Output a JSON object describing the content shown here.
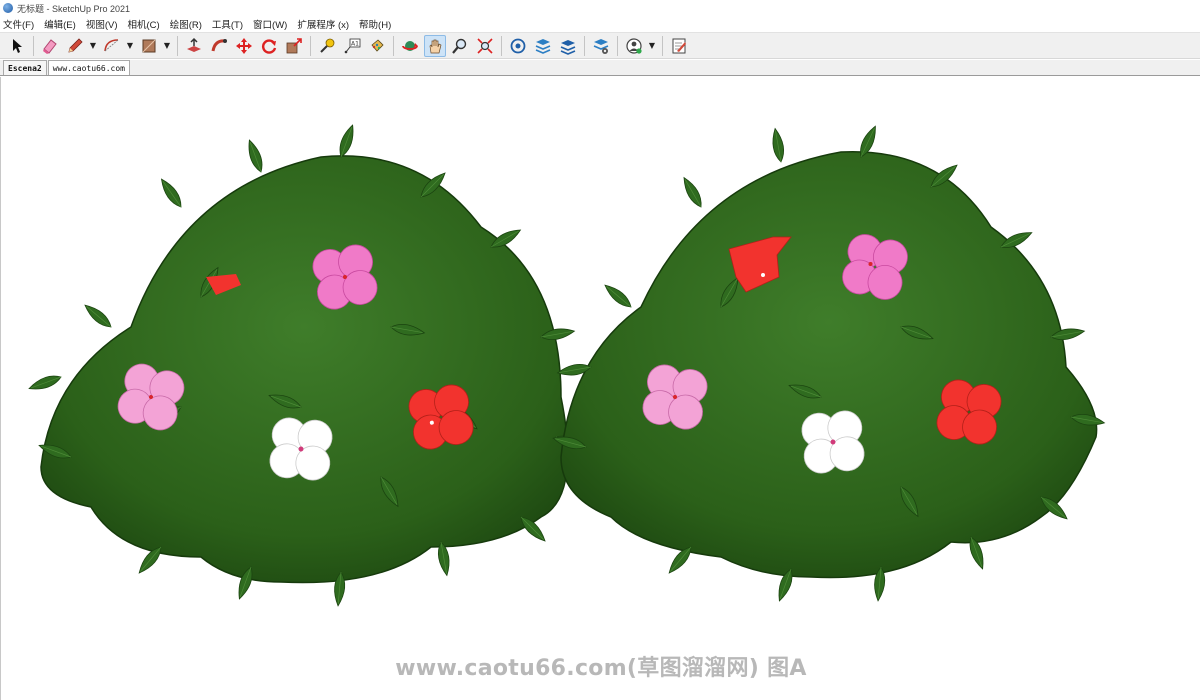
{
  "window": {
    "title": "无标题 - SketchUp Pro 2021"
  },
  "menu": [
    "文件(F)",
    "编辑(E)",
    "视图(V)",
    "相机(C)",
    "绘图(R)",
    "工具(T)",
    "窗口(W)",
    "扩展程序 (x)",
    "帮助(H)"
  ],
  "tabs": [
    "Escena2",
    "www.caotu66.com"
  ],
  "watermark": "www.caotu66.com(草图溜溜网) 图A",
  "colors": {
    "leaf": "#2f6b1f",
    "leaf_dark": "#1d4512",
    "flower_pink": "#f07ac8",
    "flower_light_pink": "#f3a3d6",
    "flower_red": "#f2332e",
    "flower_white": "#ffffff"
  },
  "toolbar_icons": [
    "select-icon",
    "eraser-icon",
    "pencil-icon",
    "arc-icon",
    "rectangle-icon",
    "push-pull-icon",
    "follow-me-icon",
    "move-icon",
    "rotate-icon",
    "scale-icon",
    "tape-measure-icon",
    "text-icon",
    "paint-bucket-icon",
    "orbit-icon",
    "pan-icon",
    "zoom-icon",
    "zoom-extents-icon",
    "warehouse-icon",
    "extension-warehouse-icon",
    "layout-icon",
    "extension-manager-icon",
    "account-icon",
    "preferences-icon"
  ]
}
